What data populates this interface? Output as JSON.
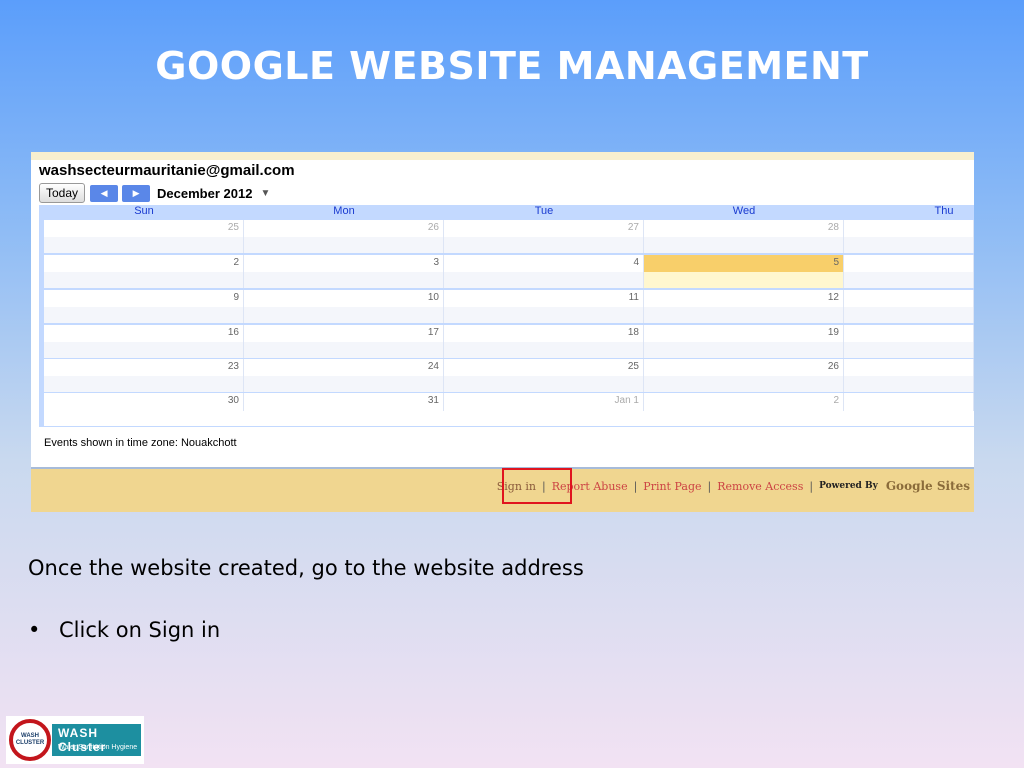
{
  "slide": {
    "title": "GOOGLE WEBSITE MANAGEMENT",
    "body_text": "Once the website created, go to the website address",
    "bullet_marker": "•",
    "bullet_text": "Click on Sign in"
  },
  "calendar": {
    "owner": "washsecteurmauritanie@gmail.com",
    "today_label": "Today",
    "prev_icon": "◀",
    "next_icon": "▶",
    "month": "December 2012",
    "month_caret": "▼",
    "day_headers": [
      "Sun",
      "Mon",
      "Tue",
      "Wed",
      "Thu"
    ],
    "weeks": [
      [
        "25",
        "26",
        "27",
        "28",
        ""
      ],
      [
        "2",
        "3",
        "4",
        "5",
        ""
      ],
      [
        "9",
        "10",
        "11",
        "12",
        ""
      ],
      [
        "16",
        "17",
        "18",
        "19",
        ""
      ],
      [
        "23",
        "24",
        "25",
        "26",
        ""
      ],
      [
        "30",
        "31",
        "Jan 1",
        "2",
        ""
      ]
    ],
    "today_date": "5",
    "timezone": "Events shown in time zone: Nouakchott"
  },
  "footer": {
    "sign_in": "Sign in",
    "report_abuse": "Report Abuse",
    "print_page": "Print Page",
    "remove_access": "Remove Access",
    "separator": "|",
    "powered_by": "Powered By",
    "google_sites": "Google Sites"
  },
  "logo": {
    "badge_text": "WASH CLUSTER",
    "title": "WASH Cluster",
    "subtitle": "Water Sanitation Hygiene"
  },
  "colors": {
    "highlight_box": "#e0141e",
    "today_cell": "#f8cf6a",
    "footer_bg": "#f0d690",
    "link": "#cc4444"
  }
}
